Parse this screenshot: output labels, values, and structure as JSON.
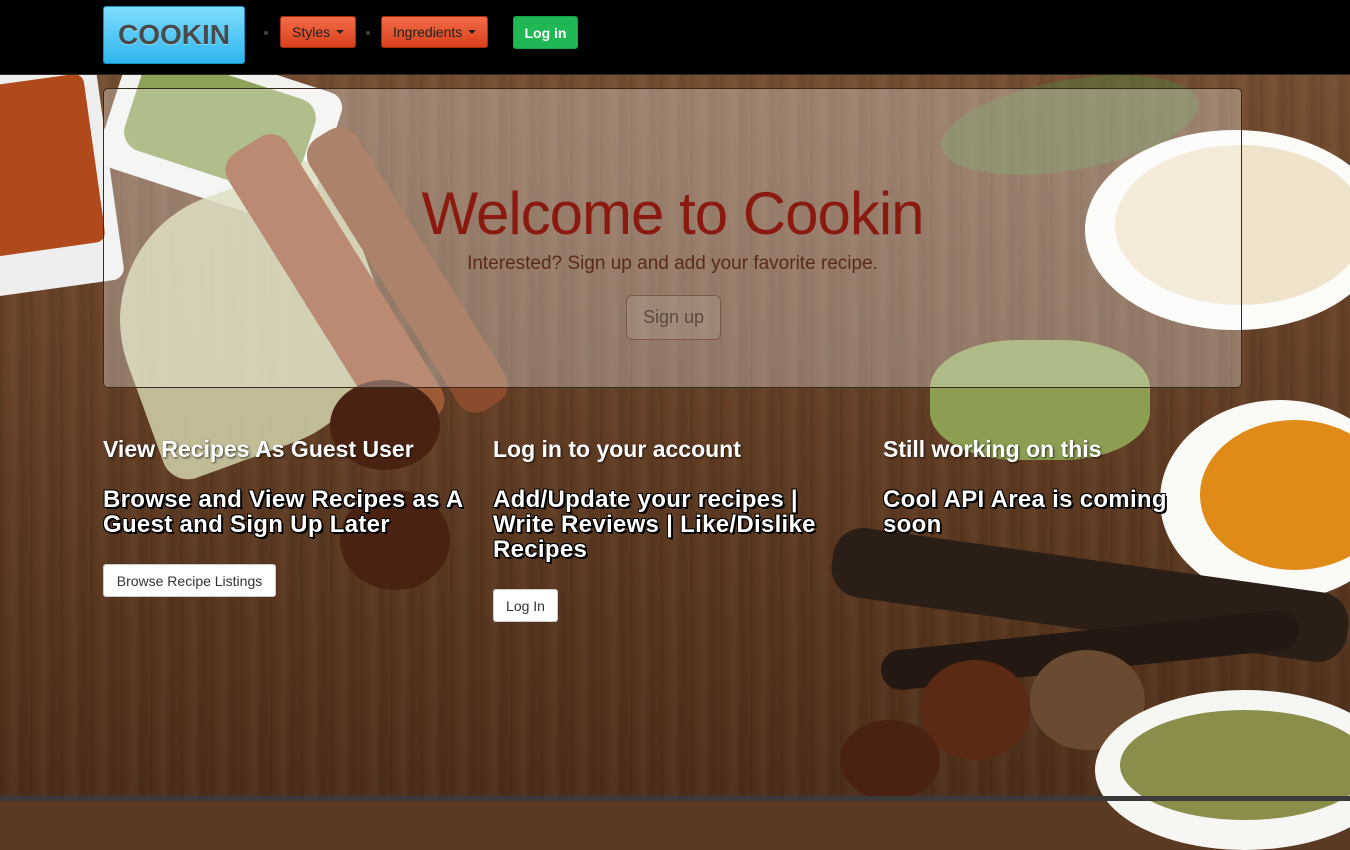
{
  "navbar": {
    "brand": "COOKIN",
    "styles_label": "Styles",
    "ingredients_label": "Ingredients",
    "login_label": "Log in"
  },
  "jumbotron": {
    "title": "Welcome to Cookin",
    "lead": "Interested? Sign up and add your favorite recipe.",
    "signup_label": "Sign up"
  },
  "columns": [
    {
      "heading": "View Recipes As Guest User",
      "subheading": "Browse and View Recipes as A Guest and Sign Up Later",
      "button_label": "Browse Recipe Listings"
    },
    {
      "heading": "Log in to your account",
      "subheading": "Add/Update your recipes | Write Reviews | Like/Dislike Recipes",
      "button_label": "Log In"
    },
    {
      "heading": "Still working on this",
      "subheading": "Cool API Area is coming soon"
    }
  ],
  "colors": {
    "navbar_bg": "#000000",
    "brand_bg": "#2db6ec",
    "dropdown_bg": "#e0502c",
    "login_bg": "#1fb855",
    "title_color": "#8a1a10"
  }
}
